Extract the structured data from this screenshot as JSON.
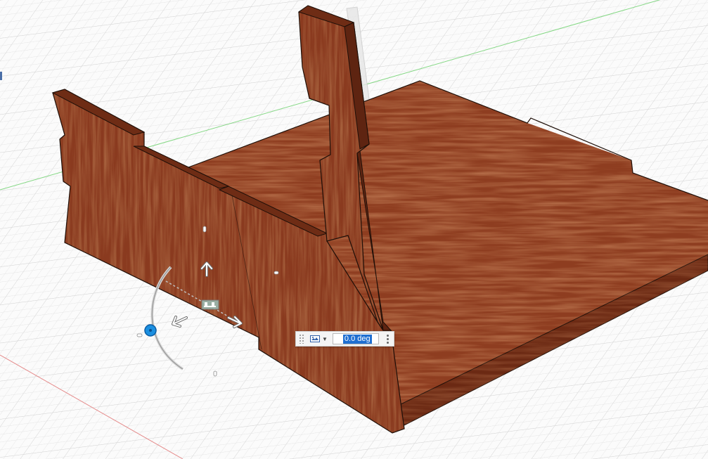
{
  "viewport": {
    "description_free": true,
    "grid": {
      "visible": true,
      "color_minor": "#e2e2e2",
      "color_major": "#d2d2d2"
    },
    "axes": {
      "x_color": "#e27a7a",
      "y_color": "#7fd67f"
    },
    "material": {
      "name": "cherry-wood",
      "base": "#8a3a1f",
      "light": "#a9502c",
      "dark": "#5c2310",
      "edge": "#1e0f08"
    }
  },
  "manipulator": {
    "rotation_value": "0.0 deg",
    "mode_icon": "rotate-mode-icon",
    "more_icon": "more-options-icon"
  }
}
